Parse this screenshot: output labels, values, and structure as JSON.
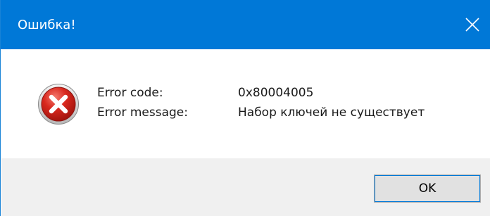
{
  "window": {
    "title": "Ошибка!",
    "titlebar_color": "#0078d7"
  },
  "content": {
    "icon": "error-icon",
    "error_code_label": "Error code:",
    "error_code_value": "0x80004005",
    "error_message_label": "Error message:",
    "error_message_value": "Набор ключей не существует"
  },
  "footer": {
    "ok_label": "OK"
  }
}
